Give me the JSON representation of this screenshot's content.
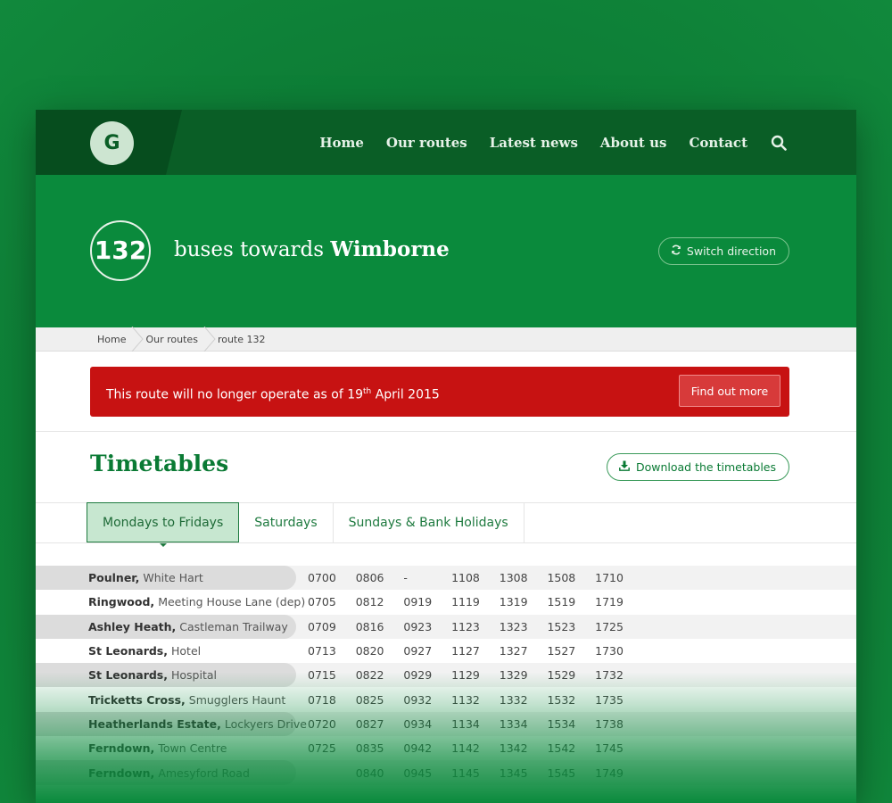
{
  "brand": {
    "logo_letter": "G"
  },
  "nav": {
    "items": [
      "Home",
      "Our routes",
      "Latest news",
      "About us",
      "Contact"
    ],
    "search_icon": "search-icon"
  },
  "hero": {
    "route_number": "132",
    "title_prefix": "buses towards",
    "destination": "Wimborne",
    "switch_label": "Switch direction",
    "switch_icon": "refresh-icon"
  },
  "breadcrumb": [
    "Home",
    "Our routes",
    "route 132"
  ],
  "alert": {
    "text_before": "This route will no longer operate as of 19",
    "text_sup": "th",
    "text_after": " April 2015",
    "button": "Find out more"
  },
  "timetables": {
    "title": "Timetables",
    "download_label": "Download the timetables",
    "download_icon": "download-icon",
    "tabs": [
      "Mondays to Fridays",
      "Saturdays",
      "Sundays & Bank Holidays"
    ],
    "active_tab": "Mondays to Fridays",
    "rows": [
      {
        "stop": "Poulner,",
        "place": "White Hart",
        "times": [
          "0700",
          "0806",
          "-",
          "1108",
          "1308",
          "1508",
          "1710"
        ]
      },
      {
        "stop": "Ringwood,",
        "place": "Meeting House Lane (dep)",
        "times": [
          "0705",
          "0812",
          "0919",
          "1119",
          "1319",
          "1519",
          "1719"
        ]
      },
      {
        "stop": "Ashley Heath,",
        "place": "Castleman Trailway",
        "times": [
          "0709",
          "0816",
          "0923",
          "1123",
          "1323",
          "1523",
          "1725"
        ]
      },
      {
        "stop": "St Leonards,",
        "place": "Hotel",
        "times": [
          "0713",
          "0820",
          "0927",
          "1127",
          "1327",
          "1527",
          "1730"
        ]
      },
      {
        "stop": "St Leonards,",
        "place": "Hospital",
        "times": [
          "0715",
          "0822",
          "0929",
          "1129",
          "1329",
          "1529",
          "1732"
        ]
      },
      {
        "stop": "Tricketts Cross,",
        "place": "Smugglers Haunt",
        "times": [
          "0718",
          "0825",
          "0932",
          "1132",
          "1332",
          "1532",
          "1735"
        ]
      },
      {
        "stop": "Heatherlands Estate,",
        "place": "Lockyers Drive",
        "times": [
          "0720",
          "0827",
          "0934",
          "1134",
          "1334",
          "1534",
          "1738"
        ]
      },
      {
        "stop": "Ferndown,",
        "place": "Town Centre",
        "times": [
          "0725",
          "0835",
          "0942",
          "1142",
          "1342",
          "1542",
          "1745"
        ]
      },
      {
        "stop": "Ferndown,",
        "place": "Amesyford Road",
        "times": [
          "",
          "0840",
          "0945",
          "1145",
          "1345",
          "1545",
          "1749"
        ]
      }
    ]
  },
  "colors": {
    "background": "#0c7a34",
    "header": "#0a5e26",
    "hero": "#0a8a3c",
    "alert": "#c71212",
    "accent_text": "#0a7a34"
  }
}
